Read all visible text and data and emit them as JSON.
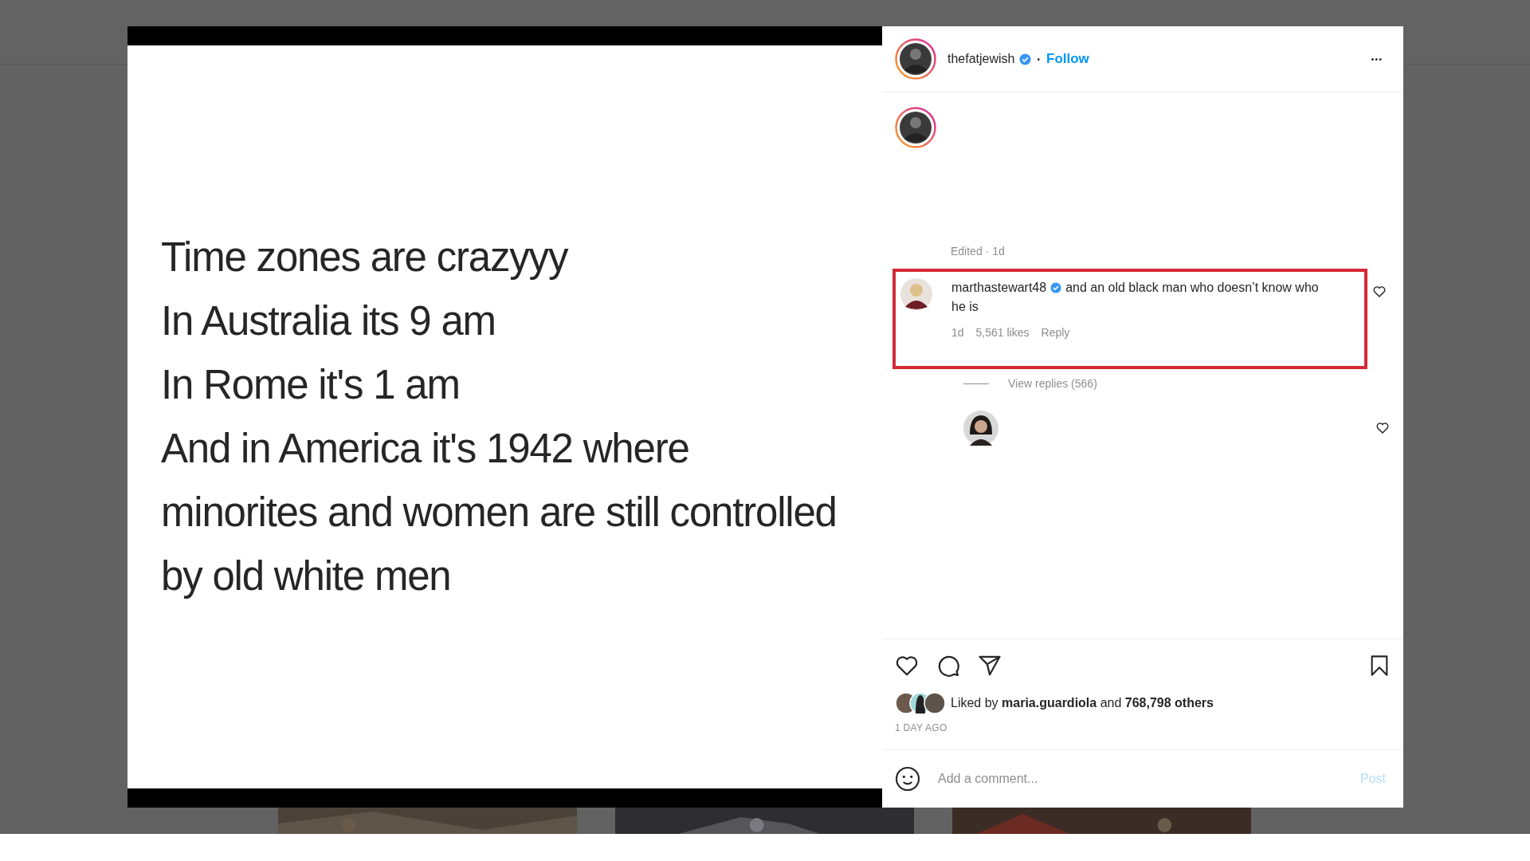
{
  "post": {
    "text_lines": [
      "Time zones are crazyyy",
      "In Australia its 9 am",
      "In Rome it's 1 am",
      "And in America it's 1942 where",
      "minorites and women are still controlled",
      "by old white men"
    ]
  },
  "header": {
    "username": "thefatjewish",
    "verified": true,
    "separator": "•",
    "follow": "Follow",
    "more": "•••"
  },
  "caption": {
    "meta": "Edited · 1d"
  },
  "comments": [
    {
      "username": "marthastewart48",
      "verified": true,
      "text": "and an old black man who doesn’t know who he is",
      "time": "1d",
      "likes": "5,561 likes",
      "reply": "Reply",
      "highlighted": true,
      "view_replies": "View replies (566)"
    },
    {
      "highlighted": false
    }
  ],
  "actions": {
    "liked_by": "Liked by **maria.guardiola** and **768,798 others**",
    "date": "1 DAY AGO"
  },
  "comment_box": {
    "placeholder": "Add a comment...",
    "post": "Post",
    "disabled": true
  }
}
